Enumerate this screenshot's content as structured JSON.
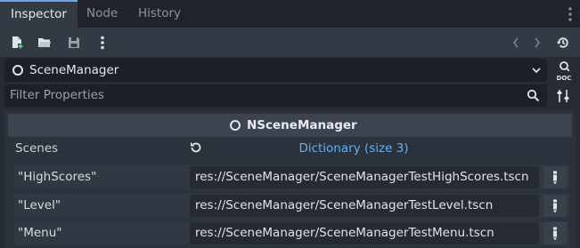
{
  "tabs": [
    {
      "label": "Inspector",
      "active": true
    },
    {
      "label": "Node",
      "active": false
    },
    {
      "label": "History",
      "active": false
    }
  ],
  "toolbar": {
    "icons": [
      "new-resource-icon",
      "load-resource-icon",
      "save-icon",
      "more-menu-icon",
      "back-icon",
      "forward-icon",
      "history-icon"
    ]
  },
  "object": {
    "name": "SceneManager"
  },
  "filter": {
    "placeholder": "Filter Properties"
  },
  "section": {
    "title": "NSceneManager"
  },
  "property": {
    "label": "Scenes",
    "value_summary": "Dictionary (size 3)"
  },
  "entries": [
    {
      "key": "\"HighScores\"",
      "value": "res://SceneManager/SceneManagerTestHighScores.tscn"
    },
    {
      "key": "\"Level\"",
      "value": "res://SceneManager/SceneManagerTestLevel.tscn"
    },
    {
      "key": "\"Menu\"",
      "value": "res://SceneManager/SceneManagerTestMenu.tscn"
    }
  ],
  "colors": {
    "accent": "#6ea5e8",
    "link": "#63aef5",
    "background": "#262b34"
  }
}
